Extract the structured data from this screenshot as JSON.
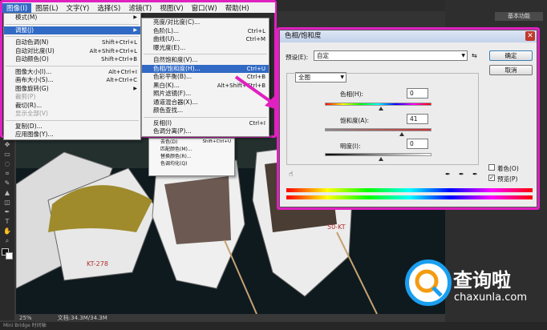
{
  "menubar": [
    "图像(I)",
    "图层(L)",
    "文字(Y)",
    "选择(S)",
    "滤镜(T)",
    "视图(V)",
    "窗口(W)",
    "帮助(H)"
  ],
  "image_menu": [
    {
      "label": "模式(M)",
      "shortcut": "",
      "submenu": true
    },
    {
      "sep": true
    },
    {
      "label": "调整(J)",
      "shortcut": "",
      "submenu": true,
      "highlight": true
    },
    {
      "sep": true
    },
    {
      "label": "自动色调(N)",
      "shortcut": "Shift+Ctrl+L"
    },
    {
      "label": "自动对比度(U)",
      "shortcut": "Alt+Shift+Ctrl+L"
    },
    {
      "label": "自动颜色(O)",
      "shortcut": "Shift+Ctrl+B"
    },
    {
      "sep": true
    },
    {
      "label": "图像大小(I)...",
      "shortcut": "Alt+Ctrl+I"
    },
    {
      "label": "画布大小(S)...",
      "shortcut": "Alt+Ctrl+C"
    },
    {
      "label": "图像旋转(G)",
      "shortcut": "",
      "submenu": true
    },
    {
      "label": "裁剪(P)",
      "shortcut": "",
      "disabled": true
    },
    {
      "label": "裁切(R)...",
      "shortcut": ""
    },
    {
      "label": "显示全部(V)",
      "shortcut": "",
      "disabled": true
    },
    {
      "sep": true
    },
    {
      "label": "复制(D)...",
      "shortcut": ""
    },
    {
      "label": "应用图像(Y)...",
      "shortcut": ""
    }
  ],
  "adjust_menu": [
    {
      "label": "亮度/对比度(C)...",
      "shortcut": ""
    },
    {
      "label": "色阶(L)...",
      "shortcut": "Ctrl+L"
    },
    {
      "label": "曲线(U)...",
      "shortcut": "Ctrl+M"
    },
    {
      "label": "曝光度(E)...",
      "shortcut": ""
    },
    {
      "sep": true
    },
    {
      "label": "自然饱和度(V)...",
      "shortcut": ""
    },
    {
      "label": "色相/饱和度(H)...",
      "shortcut": "Ctrl+U",
      "highlight": true
    },
    {
      "label": "色彩平衡(B)...",
      "shortcut": "Ctrl+B"
    },
    {
      "label": "黑白(K)...",
      "shortcut": "Alt+Shift+Ctrl+B"
    },
    {
      "label": "照片滤镜(F)...",
      "shortcut": ""
    },
    {
      "label": "通道混合器(X)...",
      "shortcut": ""
    },
    {
      "label": "颜色查找...",
      "shortcut": ""
    },
    {
      "sep": true
    },
    {
      "label": "反相(I)",
      "shortcut": "Ctrl+I"
    },
    {
      "label": "色调分离(P)...",
      "shortcut": ""
    }
  ],
  "ghost_menu": [
    "去色(D)",
    "匹配颜色(M)...",
    "替换颜色(R)...",
    "色调均化(Q)"
  ],
  "ghost_shortcut": "Shift+Ctrl+U",
  "dialog": {
    "title": "色相/饱和度",
    "preset_label": "预设(E):",
    "preset_value": "自定",
    "channel_value": "全图",
    "hue_label": "色相(H):",
    "hue_value": "0",
    "saturation_label": "饱和度(A):",
    "saturation_value": "41",
    "lightness_label": "明度(I):",
    "lightness_value": "0",
    "ok_label": "确定",
    "cancel_label": "取消",
    "colorize_label": "着色(O)",
    "preview_label": "预览(P)",
    "colorize_checked": false,
    "preview_checked": true
  },
  "statusbar": {
    "zoom": "25%",
    "doc": "文档:34.3M/34.3M"
  },
  "bottombar": "Mini Bridge    时间轴",
  "ps_header": "基本功能",
  "boat_labels": [
    "KT-278",
    "50-KT"
  ],
  "watermark": {
    "text": "查询啦",
    "url": "chaxunla.com"
  },
  "colors": {
    "frame": "#e020c0",
    "highlight": "#316ac5",
    "watermark_blue": "#1a9ff0"
  }
}
